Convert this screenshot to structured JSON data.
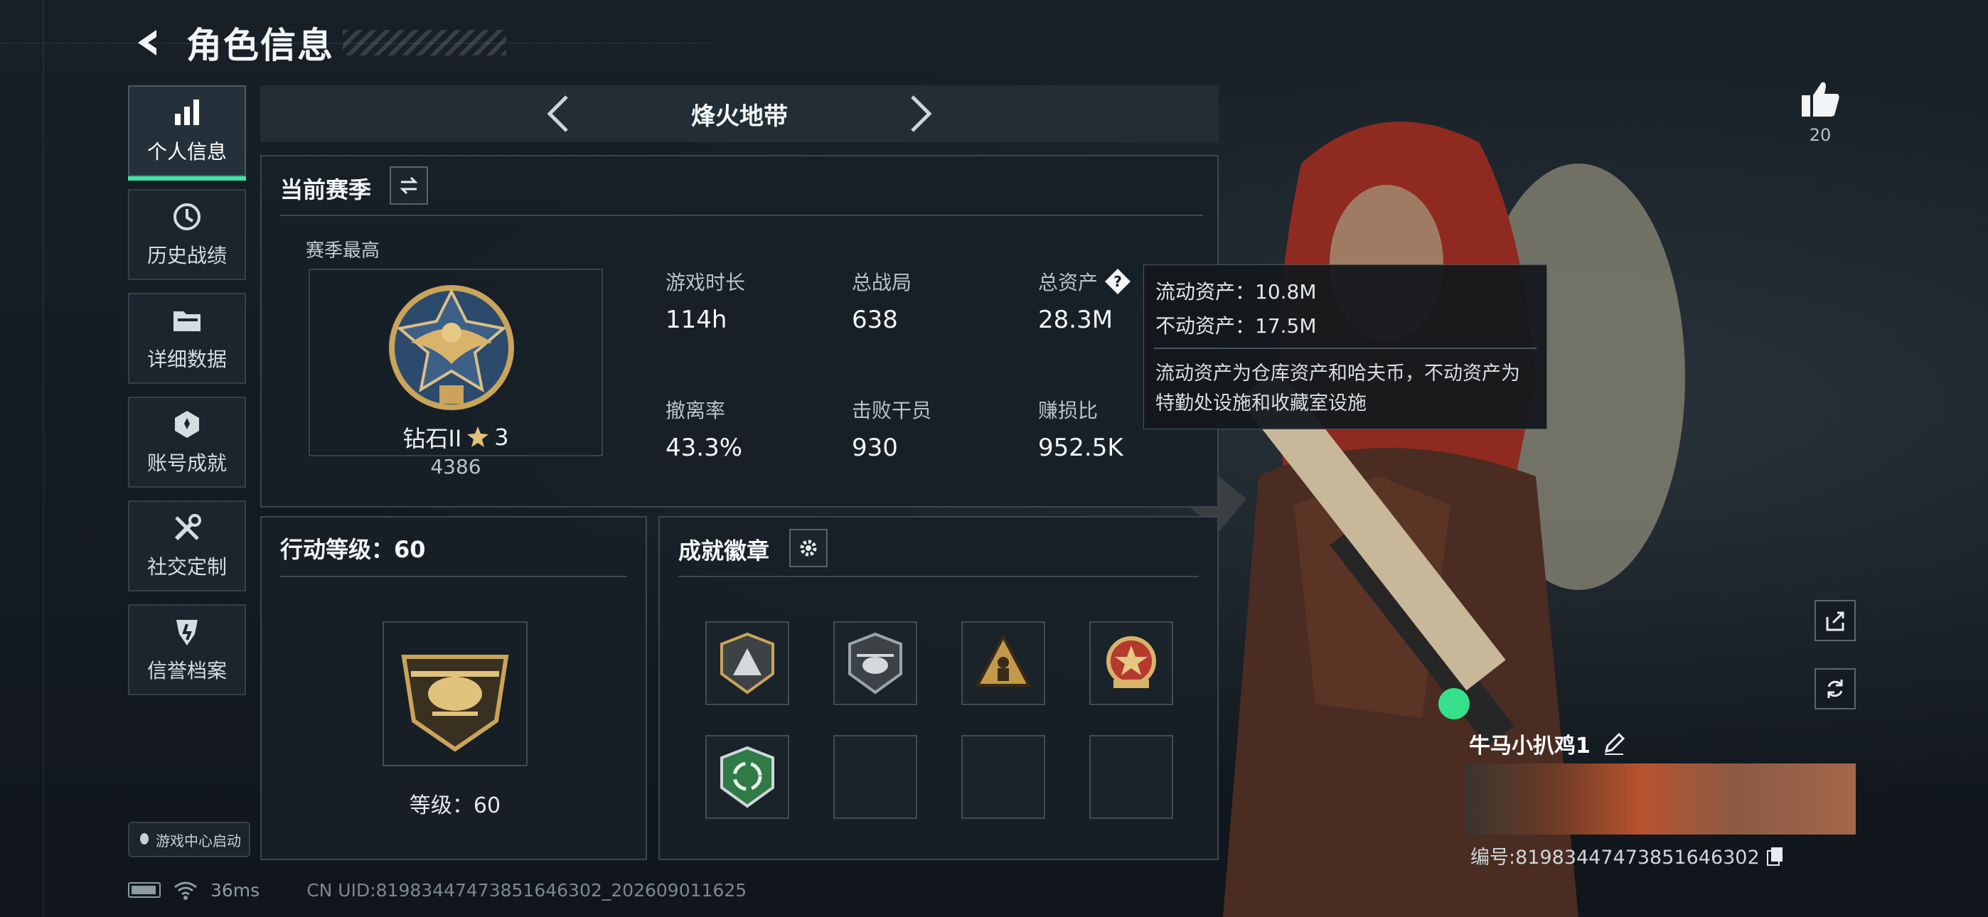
{
  "header": {
    "title": "角色信息"
  },
  "sidebar": {
    "items": [
      {
        "label": "个人信息",
        "icon": "bar-chart-icon",
        "active": true
      },
      {
        "label": "历史战绩",
        "icon": "clock-icon",
        "active": false
      },
      {
        "label": "详细数据",
        "icon": "folder-icon",
        "active": false
      },
      {
        "label": "账号成就",
        "icon": "achievement-icon",
        "active": false
      },
      {
        "label": "社交定制",
        "icon": "tools-icon",
        "active": false
      },
      {
        "label": "信誉档案",
        "icon": "shield-icon",
        "active": false
      }
    ],
    "launch_label": "游戏中心启动"
  },
  "mode": {
    "name": "烽火地带"
  },
  "season": {
    "title": "当前赛季",
    "highest_label": "赛季最高",
    "rank_name": "钻石II",
    "rank_stars": "3",
    "rank_points": "4386",
    "stats": [
      {
        "label": "游戏时长",
        "value": "114h"
      },
      {
        "label": "总战局",
        "value": "638"
      },
      {
        "label": "总资产",
        "value": "28.3M"
      },
      {
        "label": "撤离率",
        "value": "43.3%"
      },
      {
        "label": "击败干员",
        "value": "930"
      },
      {
        "label": "赚损比",
        "value": "952.5K"
      }
    ]
  },
  "tooltip": {
    "liquid": "流动资产：10.8M",
    "fixed": "不动资产：17.5M",
    "description": "流动资产为仓库资产和哈夫币，不动资产为特勤处设施和收藏室设施"
  },
  "action_level": {
    "title": "行动等级：60",
    "level_label": "等级：60"
  },
  "badges": {
    "title": "成就徽章",
    "slots": [
      "badge-a",
      "badge-b",
      "badge-c",
      "badge-d",
      "badge-e",
      "empty",
      "empty",
      "empty"
    ]
  },
  "likes": {
    "count": "20"
  },
  "player": {
    "name": "牛马小扒鸡1",
    "id": "编号:81983447473851646302"
  },
  "status": {
    "ping": "36ms",
    "uid": "CN UID:81983447473851646302_202609011625"
  },
  "colors": {
    "accent": "#42e3a5",
    "panel": "#18202a",
    "gold": "#c9a45a"
  }
}
